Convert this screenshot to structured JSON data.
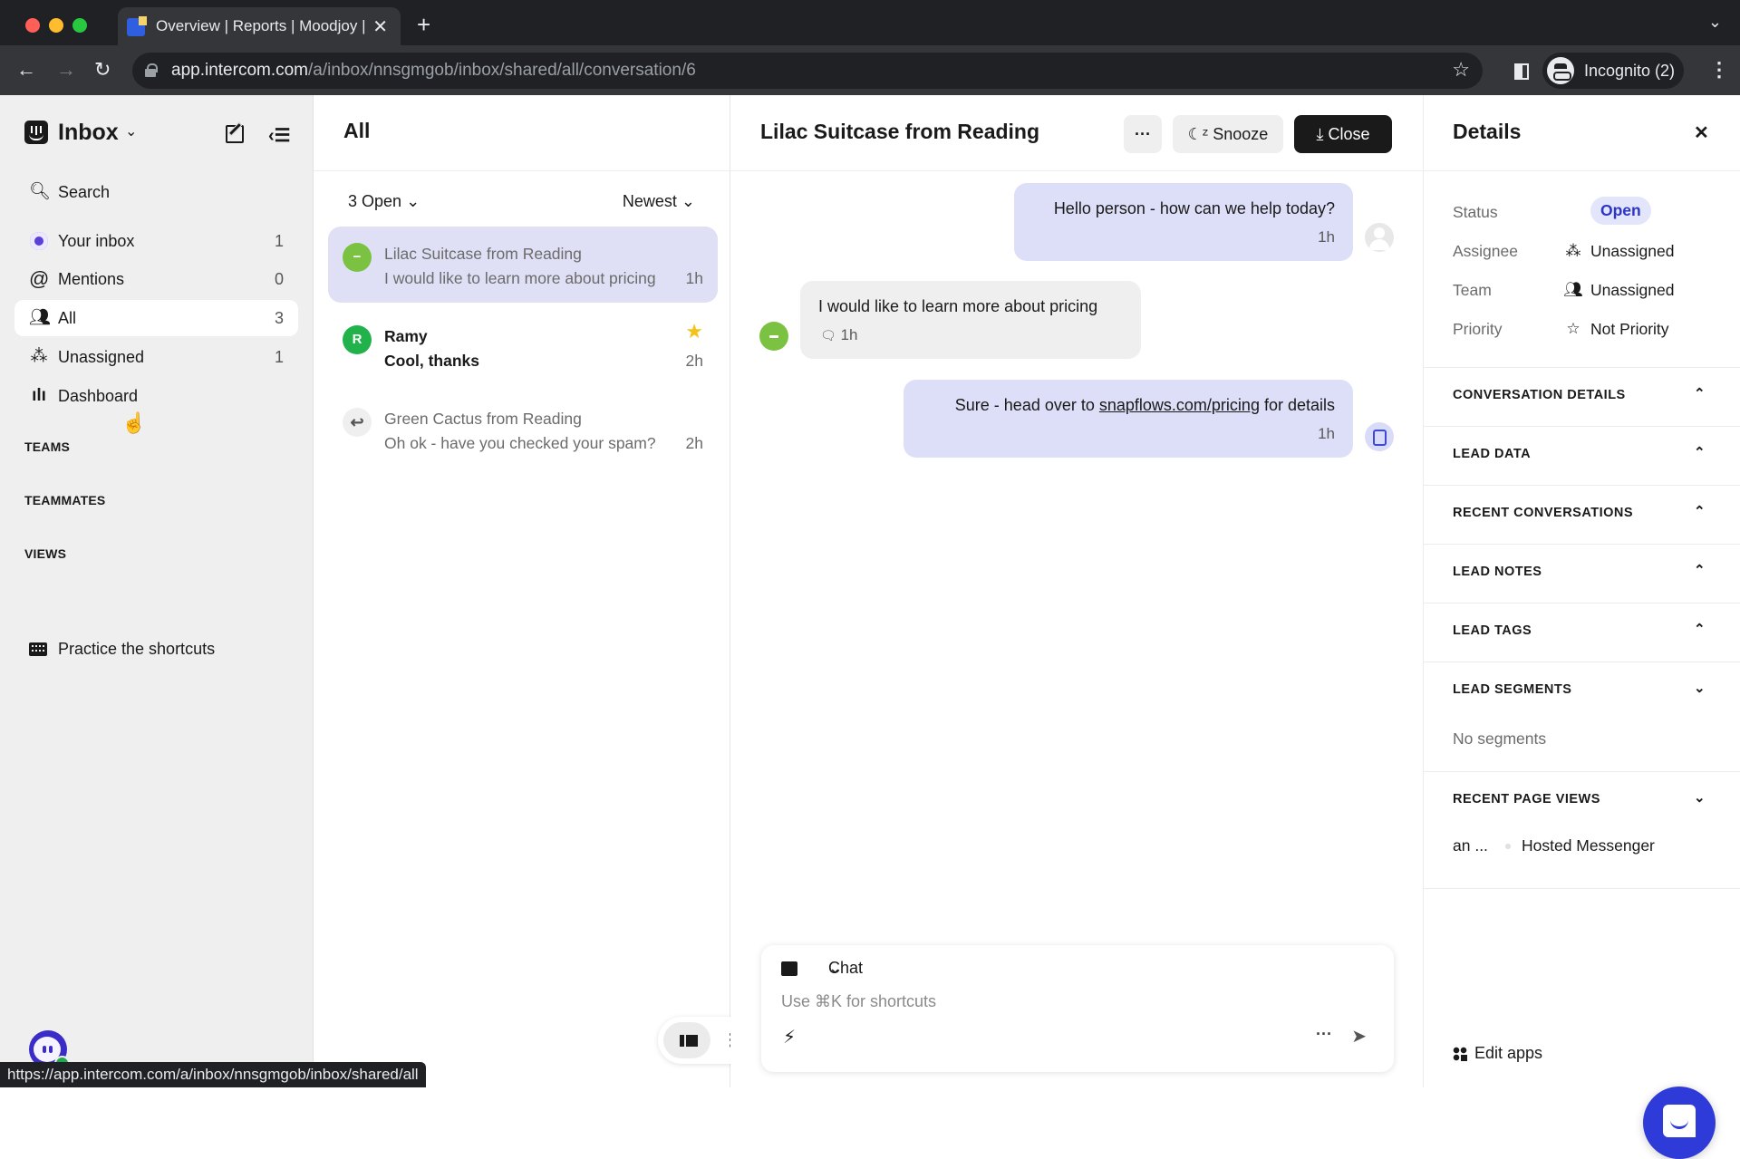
{
  "browser": {
    "tab_title": "Overview | Reports | Moodjoy |",
    "url_host": "app.intercom.com",
    "url_path": "/a/inbox/nnsgmgob/inbox/shared/all/conversation/6",
    "profile_label": "Incognito (2)",
    "status_url": "https://app.intercom.com/a/inbox/nnsgmgob/inbox/shared/all"
  },
  "sidebar": {
    "title": "Inbox",
    "search_label": "Search",
    "items": [
      {
        "label": "Your inbox",
        "count": "1",
        "icon": "your-inbox-icon"
      },
      {
        "label": "Mentions",
        "count": "0",
        "icon": "at-icon"
      },
      {
        "label": "All",
        "count": "3",
        "icon": "team-icon",
        "active": true
      },
      {
        "label": "Unassigned",
        "count": "1",
        "icon": "unassigned-icon"
      },
      {
        "label": "Dashboard",
        "count": "",
        "icon": "bar-chart-icon"
      }
    ],
    "sections": [
      "TEAMS",
      "TEAMMATES",
      "VIEWS"
    ],
    "shortcuts_label": "Practice the shortcuts"
  },
  "list": {
    "title": "All",
    "filter_label": "3 Open",
    "sort_label": "Newest",
    "conversations": [
      {
        "name": "Lilac Suitcase from Reading",
        "preview": "I would like to learn more about pricing",
        "time": "1h",
        "selected": true,
        "unread": false
      },
      {
        "name": "Ramy",
        "preview": "Cool, thanks",
        "time": "2h",
        "avatar_letter": "R",
        "starred": true,
        "unread": true
      },
      {
        "name": "Green Cactus from Reading",
        "preview": "Oh ok - have you checked your spam?",
        "time": "2h",
        "replied": true,
        "unread": false
      }
    ]
  },
  "conversation": {
    "title": "Lilac Suitcase from Reading",
    "more_label": "···",
    "snooze_label": "Snooze",
    "close_label": "Close",
    "messages": [
      {
        "direction": "out",
        "text": "Hello person - how can we help today?",
        "time": "1h"
      },
      {
        "direction": "in",
        "text": "I would like to learn more about pricing",
        "time": "1h"
      },
      {
        "direction": "out",
        "text_before": "Sure - head over to ",
        "link": "snapflows.com/pricing",
        "text_after": " for details",
        "time": "1h"
      }
    ],
    "composer": {
      "mode_label": "Chat",
      "placeholder": "Use ⌘K for shortcuts"
    }
  },
  "details": {
    "title": "Details",
    "attributes": [
      {
        "key": "Status",
        "value": "Open"
      },
      {
        "key": "Assignee",
        "value": "Unassigned"
      },
      {
        "key": "Team",
        "value": "Unassigned"
      },
      {
        "key": "Priority",
        "value": "Not Priority"
      }
    ],
    "sections": [
      {
        "label": "CONVERSATION DETAILS",
        "expanded": false
      },
      {
        "label": "LEAD DATA",
        "expanded": false
      },
      {
        "label": "RECENT CONVERSATIONS",
        "expanded": false
      },
      {
        "label": "LEAD NOTES",
        "expanded": false
      },
      {
        "label": "LEAD TAGS",
        "expanded": false
      },
      {
        "label": "LEAD SEGMENTS",
        "expanded": true
      },
      {
        "label": "RECENT PAGE VIEWS",
        "expanded": true
      }
    ],
    "segments_empty": "No segments",
    "page_view_time": "an ...",
    "page_view_title": "Hosted Messenger",
    "edit_apps_label": "Edit apps"
  },
  "colors": {
    "accent": "#2e3bd8",
    "selected_row": "#dfe0f6",
    "lead_green": "#7cc242",
    "sidebar_bg": "#efefef"
  }
}
